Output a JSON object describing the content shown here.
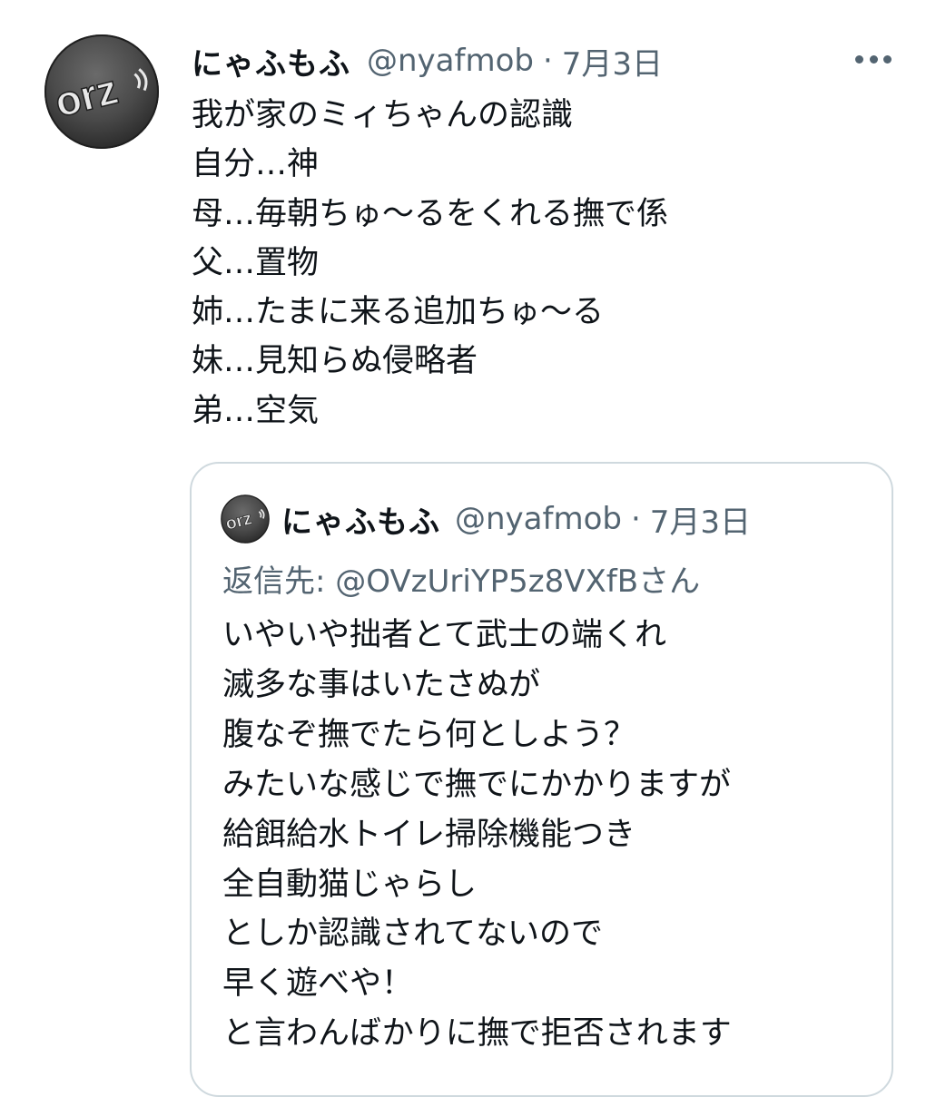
{
  "tweet": {
    "author_name": "にゃふもふ",
    "author_handle": "@nyafmob",
    "separator": "·",
    "date": "7月3日",
    "avatar_text": "orz",
    "lines": [
      "我が家のミィちゃんの認識",
      "自分…神",
      "母…毎朝ちゅ〜るをくれる撫で係",
      "父…置物",
      "姉…たまに来る追加ちゅ〜る",
      "妹…見知らぬ侵略者",
      "弟…空気"
    ]
  },
  "quoted_tweet": {
    "author_name": "にゃふもふ",
    "author_handle": "@nyafmob",
    "separator": "·",
    "date": "7月3日",
    "avatar_text": "orz",
    "reply_to": "返信先: @OVzUriYP5z8VXfBさん",
    "lines": [
      "いやいや拙者とて武士の端くれ",
      "滅多な事はいたさぬが",
      "腹なぞ撫でたら何としよう？",
      "みたいな感じで撫でにかかりますが",
      "給餌給水トイレ掃除機能つき",
      "全自動猫じゃらし",
      "としか認識されてないので",
      "早く遊べや！",
      "と言わんばかりに撫で拒否されます"
    ]
  },
  "icons": {
    "more": "more-horizontal-icon"
  },
  "colors": {
    "text_primary": "#0f1419",
    "text_secondary": "#536471",
    "border": "#cfd9de",
    "avatar_dark": "#3a3a3a"
  }
}
